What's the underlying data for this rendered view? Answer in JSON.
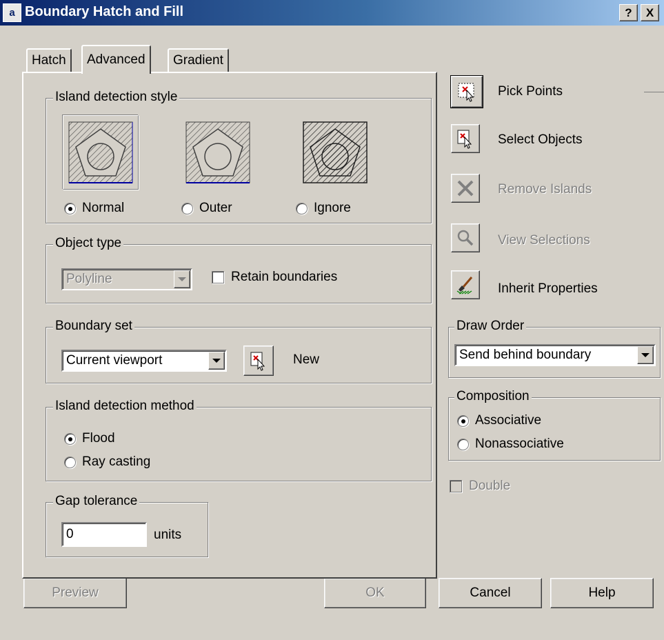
{
  "window": {
    "title": "Boundary Hatch and Fill",
    "app_icon_text": "a",
    "help_label": "?",
    "close_label": "X"
  },
  "tabs": [
    {
      "label": "Hatch",
      "active": false
    },
    {
      "label": "Advanced",
      "active": true
    },
    {
      "label": "Gradient",
      "active": false
    }
  ],
  "island_detection_style": {
    "legend": "Island detection style",
    "options": [
      {
        "label": "Normal",
        "checked": true
      },
      {
        "label": "Outer",
        "checked": false
      },
      {
        "label": "Ignore",
        "checked": false
      }
    ]
  },
  "object_type": {
    "legend": "Object type",
    "value": "Polyline",
    "retain_label": "Retain boundaries",
    "retain_checked": false
  },
  "boundary_set": {
    "legend": "Boundary set",
    "value": "Current viewport",
    "new_label": "New"
  },
  "island_detection_method": {
    "legend": "Island detection method",
    "options": [
      {
        "label": "Flood",
        "checked": true
      },
      {
        "label": "Ray casting",
        "checked": false
      }
    ]
  },
  "gap_tolerance": {
    "legend": "Gap tolerance",
    "value": "0",
    "units": "units"
  },
  "side_buttons": {
    "pick_points": "Pick Points",
    "select_objects": "Select Objects",
    "remove_islands": "Remove Islands",
    "view_selections": "View Selections",
    "inherit_properties": "Inherit Properties"
  },
  "draw_order": {
    "legend": "Draw Order",
    "value": "Send behind boundary"
  },
  "composition": {
    "legend": "Composition",
    "options": [
      {
        "label": "Associative",
        "checked": true
      },
      {
        "label": "Nonassociative",
        "checked": false
      }
    ]
  },
  "double": {
    "label": "Double",
    "checked": false,
    "enabled": false
  },
  "footer": {
    "preview": "Preview",
    "ok": "OK",
    "cancel": "Cancel",
    "help": "Help"
  },
  "colors": {
    "dialog_bg": "#d4d0c8",
    "title_bar": "#0a246a",
    "disabled_text": "#808080"
  }
}
